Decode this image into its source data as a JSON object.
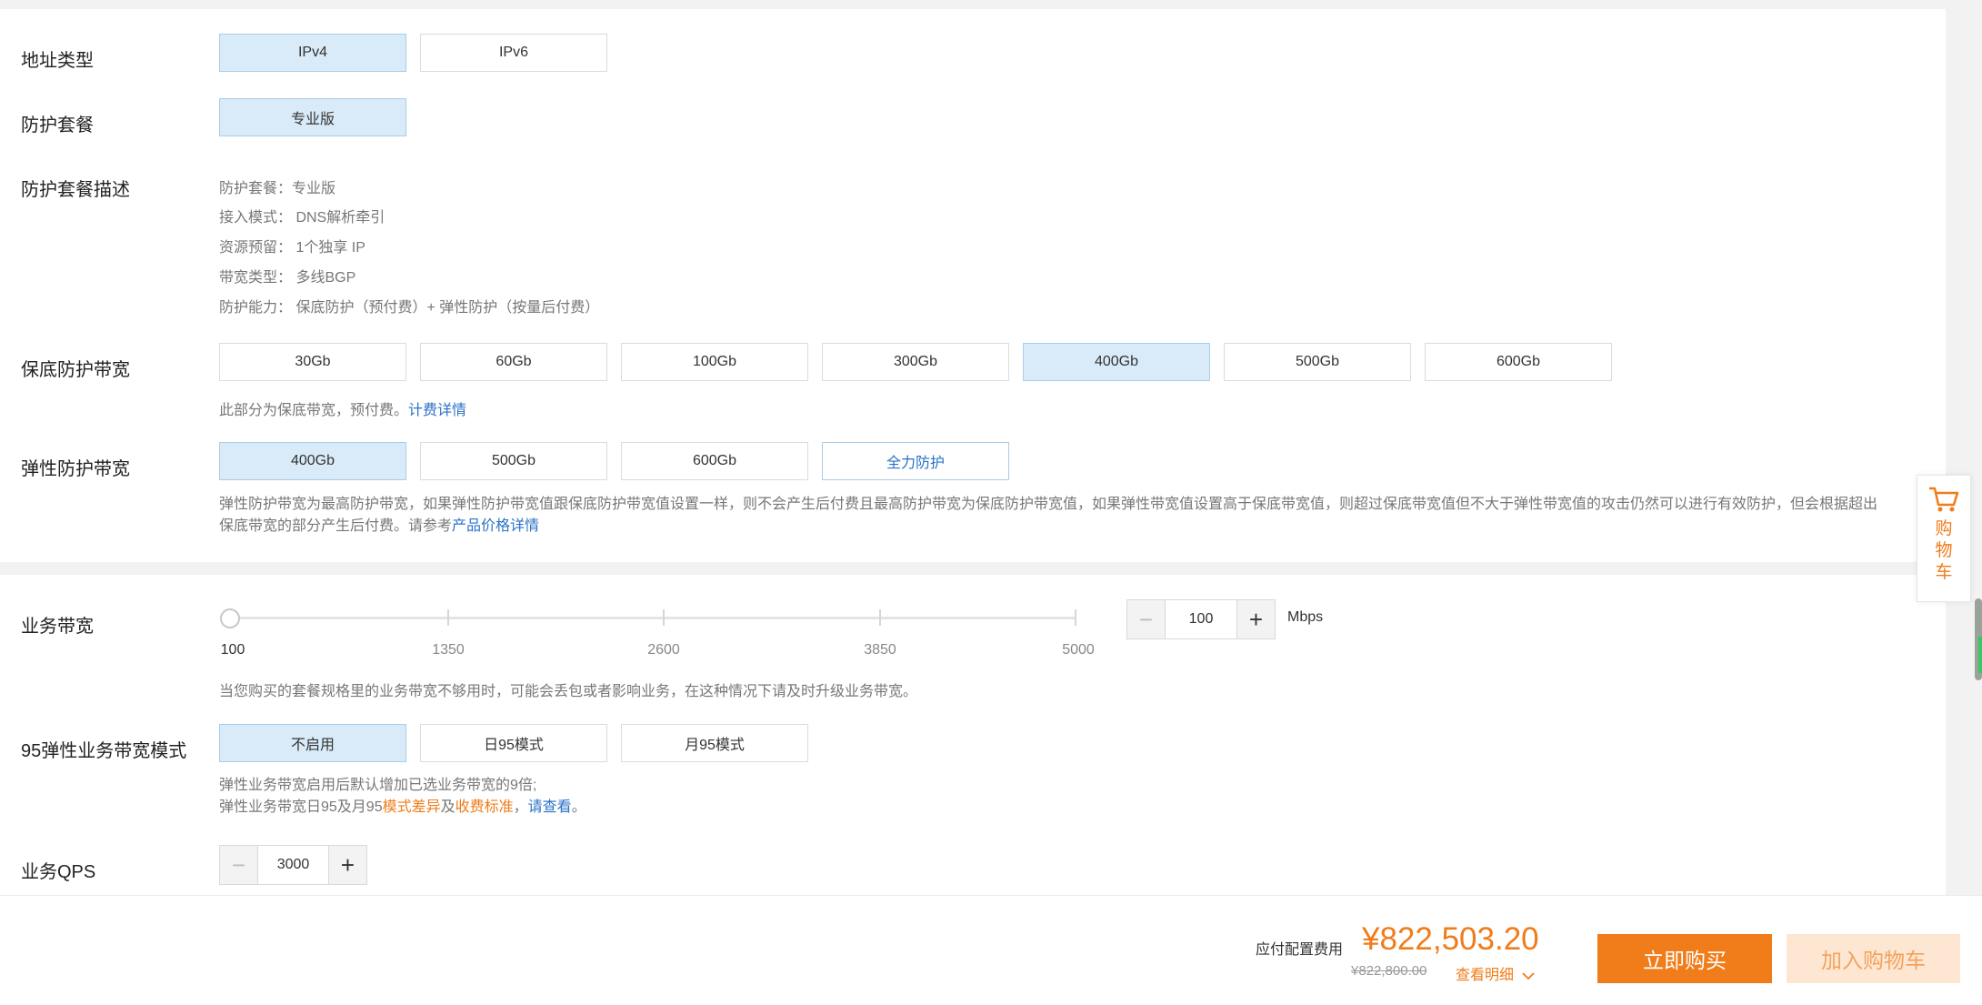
{
  "address_type": {
    "label": "地址类型",
    "options": [
      "IPv4",
      "IPv6"
    ],
    "selected": "IPv4"
  },
  "package": {
    "label": "防护套餐",
    "options": [
      "专业版"
    ],
    "selected": "专业版"
  },
  "package_desc": {
    "label": "防护套餐描述",
    "lines": [
      "防护套餐：专业版",
      "接入模式： DNS解析牵引",
      "资源预留： 1个独享 IP",
      "带宽类型： 多线BGP",
      "防护能力： 保底防护（预付费）+ 弹性防护（按量后付费）"
    ]
  },
  "base_bandwidth": {
    "label": "保底防护带宽",
    "options": [
      "30Gb",
      "60Gb",
      "100Gb",
      "300Gb",
      "400Gb",
      "500Gb",
      "600Gb"
    ],
    "selected": "400Gb",
    "note": "此部分为保底带宽，预付费。",
    "note_link": "计费详情"
  },
  "elastic_bandwidth": {
    "label": "弹性防护带宽",
    "options": [
      "400Gb",
      "500Gb",
      "600Gb",
      "全力防护"
    ],
    "selected": "400Gb",
    "note_line1": "弹性防护带宽为最高防护带宽，如果弹性防护带宽值跟保底防护带宽值设置一样，则不会产生后付费且最高防护带宽为保底防护带宽值，如果弹性带宽值设置高于保底带宽值，则超过保底带宽值但不大于弹性带宽值的攻击仍然可以进行有效防护，但会根据超出",
    "note_line2": "保底带宽的部分产生后付费。请参考",
    "note_link": "产品价格详情"
  },
  "business_bandwidth": {
    "label": "业务带宽",
    "ticks": [
      "100",
      "1350",
      "2600",
      "3850",
      "5000"
    ],
    "value": "100",
    "unit": "Mbps",
    "note": "当您购买的套餐规格里的业务带宽不够用时，可能会丢包或者影响业务，在这种情况下请及时升级业务带宽。"
  },
  "elastic_mode": {
    "label": "95弹性业务带宽模式",
    "options": [
      "不启用",
      "日95模式",
      "月95模式"
    ],
    "selected": "不启用",
    "note_line1": "弹性业务带宽启用后默认增加已选业务带宽的9倍;",
    "note_line2_prefix": "弹性业务带宽日95及月95",
    "note_link_diff": "模式差异",
    "note_and": "及",
    "note_link_fee": "收费标准",
    "note_comma": "，",
    "note_link_view": "请查看",
    "note_end": "。"
  },
  "qps": {
    "label": "业务QPS",
    "value": "3000"
  },
  "icons": {
    "minus": "minus-icon",
    "plus": "plus-icon",
    "cart": "cart-icon",
    "chevron": "chevron-down-icon"
  },
  "cart_float": {
    "chars": [
      "购",
      "物",
      "车"
    ]
  },
  "footer": {
    "fee_label": "应付配置费用",
    "price": "¥822,503.20",
    "original_price": "¥822,800.00",
    "detail_link": "查看明细",
    "buy_label": "立即购买",
    "add_cart_label": "加入购物车"
  },
  "colors": {
    "accent": "#f07c1a",
    "selected_bg": "#d9ebf8",
    "link": "#2a72c7"
  }
}
